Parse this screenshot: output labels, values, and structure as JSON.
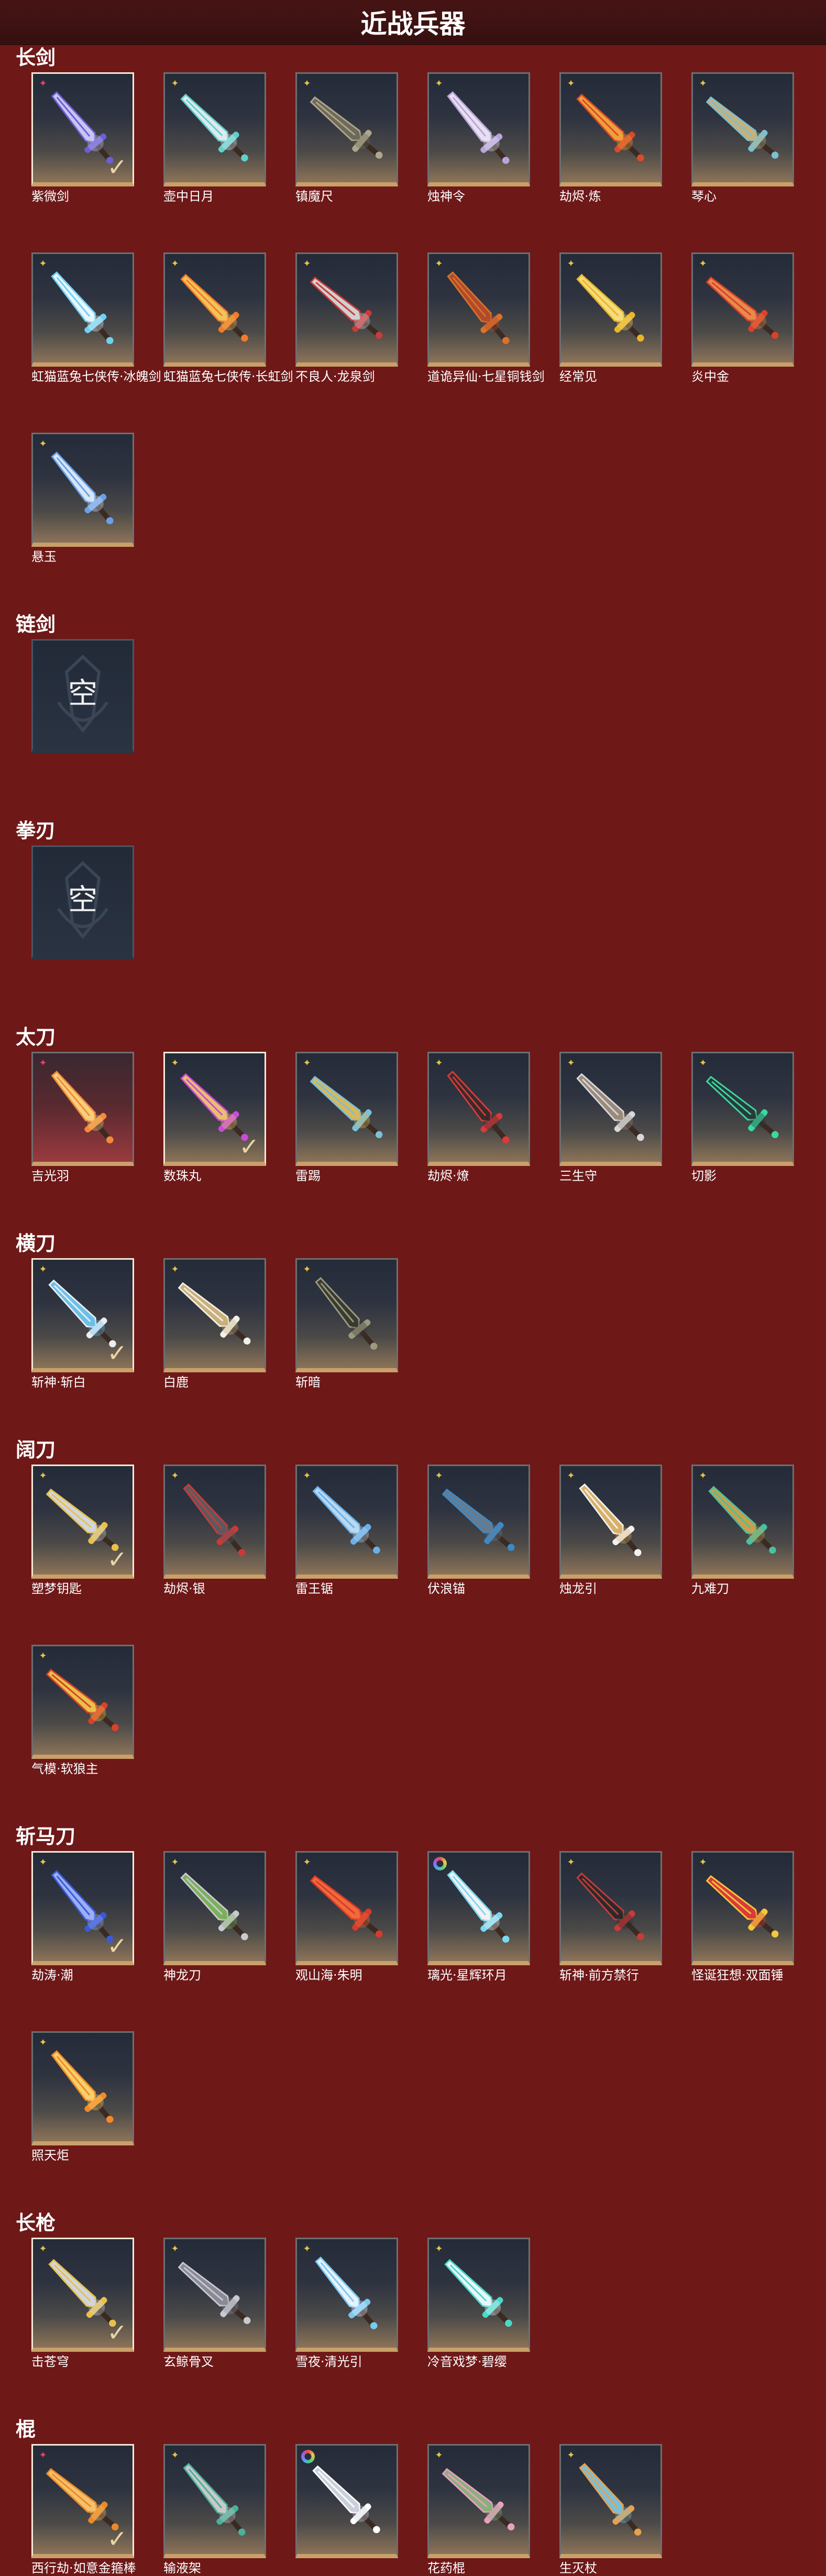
{
  "page": {
    "title": "近战兵器"
  },
  "colors": {
    "background": "#6e1818",
    "title_bar": "#3e1212",
    "card_border_gold": "#c9a06a",
    "selected_border": "#f3ead8",
    "badge_gold": "#e8c24a",
    "badge_star": "#e3436b"
  },
  "empty_slot_text": "空",
  "categories": [
    {
      "name": "长剑",
      "items": [
        {
          "name": "紫微剑",
          "badge": "star-icon",
          "selected": true,
          "colors": [
            "#6b5fd1",
            "#c9c4f2"
          ]
        },
        {
          "name": "壶中日月",
          "badge": "gold-cross-icon",
          "selected": false,
          "colors": [
            "#5fd1c9",
            "#dfe9f0"
          ]
        },
        {
          "name": "镇魔尺",
          "badge": "gold-cross-icon",
          "selected": false,
          "colors": [
            "#b0a68c",
            "#6d6a5a"
          ]
        },
        {
          "name": "烛神令",
          "badge": "gold-cross-icon",
          "selected": false,
          "colors": [
            "#b9a6d9",
            "#e8e0f2"
          ]
        },
        {
          "name": "劫烬·炼",
          "badge": "gold-cross-icon",
          "selected": false,
          "colors": [
            "#d94a2a",
            "#f0a03a"
          ]
        },
        {
          "name": "琴心",
          "badge": "gold-cross-icon",
          "selected": false,
          "colors": [
            "#7ac0d0",
            "#c9b07a"
          ]
        },
        {
          "name": "虹猫蓝兔七侠传·冰魄剑",
          "badge": "gold-cross-icon",
          "selected": false,
          "colors": [
            "#6fd0f2",
            "#e9f6fb"
          ]
        },
        {
          "name": "虹猫蓝兔七侠传·长虹剑",
          "badge": "gold-cross-icon",
          "selected": false,
          "colors": [
            "#f27a2a",
            "#f2c35a"
          ]
        },
        {
          "name": "不良人·龙泉剑",
          "badge": "gold-cross-icon",
          "selected": false,
          "colors": [
            "#c93a3a",
            "#d0d0d0"
          ]
        },
        {
          "name": "道诡异仙·七星铜钱剑",
          "badge": "gold-cross-icon",
          "selected": false,
          "colors": [
            "#d9722a",
            "#b04a2a"
          ]
        },
        {
          "name": "经常见",
          "badge": "gold-cross-icon",
          "selected": false,
          "colors": [
            "#e9b52a",
            "#f6dc7a"
          ]
        },
        {
          "name": "炎中金",
          "badge": "gold-cross-icon",
          "selected": false,
          "colors": [
            "#d9412a",
            "#e98a4a"
          ]
        },
        {
          "name": "悬玉",
          "badge": "gold-cross-icon",
          "selected": false,
          "colors": [
            "#6aa0e9",
            "#d8e6f6"
          ]
        }
      ]
    },
    {
      "name": "链剑",
      "items": [
        {
          "empty": true
        }
      ]
    },
    {
      "name": "拳刃",
      "items": [
        {
          "empty": true
        }
      ]
    },
    {
      "name": "太刀",
      "items": [
        {
          "name": "吉光羽",
          "badge": "star-icon",
          "selected": false,
          "rare": true,
          "colors": [
            "#f28a3a",
            "#f6cf7a"
          ]
        },
        {
          "name": "数珠丸",
          "badge": "gold-cross-icon",
          "selected": true,
          "colors": [
            "#c94ad9",
            "#e9c06a"
          ]
        },
        {
          "name": "雷踢",
          "badge": "gold-cross-icon",
          "selected": false,
          "colors": [
            "#7ac0d9",
            "#d9b85a"
          ]
        },
        {
          "name": "劫烬·燎",
          "badge": "gold-cross-icon",
          "selected": false,
          "colors": [
            "#d93a3a",
            "#3a2a2a"
          ]
        },
        {
          "name": "三生守",
          "badge": "gold-cross-icon",
          "selected": false,
          "colors": [
            "#d8d8dc",
            "#9a8a7a"
          ]
        },
        {
          "name": "切影",
          "badge": "gold-cross-icon",
          "selected": false,
          "colors": [
            "#3ad9a0",
            "#2a3a3a"
          ]
        }
      ]
    },
    {
      "name": "横刀",
      "items": [
        {
          "name": "斩神·斩白",
          "badge": "gold-cross-icon",
          "selected": true,
          "colors": [
            "#e9eef2",
            "#6ac0e9"
          ]
        },
        {
          "name": "白鹿",
          "badge": "gold-cross-icon",
          "selected": false,
          "colors": [
            "#f2efe6",
            "#c9b07a"
          ]
        },
        {
          "name": "斩暗",
          "badge": "gold-cross-icon",
          "selected": false,
          "colors": [
            "#9a9a80",
            "#3a3a30"
          ]
        }
      ]
    },
    {
      "name": "阔刀",
      "items": [
        {
          "name": "塑梦钥匙",
          "badge": "gold-cross-icon",
          "selected": true,
          "colors": [
            "#e9c04a",
            "#cfd6df"
          ]
        },
        {
          "name": "劫烬·银",
          "badge": "gold-cross-icon",
          "selected": false,
          "colors": [
            "#c93a3a",
            "#5a5a60"
          ]
        },
        {
          "name": "雷王锯",
          "badge": "gold-cross-icon",
          "selected": false,
          "colors": [
            "#6ab0e9",
            "#b9d9f2"
          ]
        },
        {
          "name": "伏浪锚",
          "badge": "gold-cross-icon",
          "selected": false,
          "colors": [
            "#3a8ac9",
            "#6a7a8a"
          ]
        },
        {
          "name": "烛龙引",
          "badge": "gold-cross-icon",
          "selected": false,
          "colors": [
            "#f2f2f2",
            "#d9b06a"
          ]
        },
        {
          "name": "九难刀",
          "badge": "gold-cross-icon",
          "selected": false,
          "colors": [
            "#4ac0a0",
            "#c9a04a"
          ]
        },
        {
          "name": "气模·软狼主",
          "badge": "gold-cross-icon",
          "selected": false,
          "colors": [
            "#d9412a",
            "#e9c04a"
          ]
        }
      ]
    },
    {
      "name": "斩马刀",
      "items": [
        {
          "name": "劫涛·潮",
          "badge": "gold-cross-icon",
          "selected": true,
          "colors": [
            "#3a5ad9",
            "#9ab0f2"
          ]
        },
        {
          "name": "神龙刀",
          "badge": "gold-cross-icon",
          "selected": false,
          "colors": [
            "#c9c9cf",
            "#7ab05a"
          ]
        },
        {
          "name": "观山海·朱明",
          "badge": "gold-cross-icon",
          "selected": false,
          "colors": [
            "#d93a2a",
            "#f26a3a"
          ]
        },
        {
          "name": "璃光·星辉环月",
          "badge": "rainbow-ring-icon",
          "selected": false,
          "colors": [
            "#7ad9f2",
            "#f2f2f2"
          ]
        },
        {
          "name": "斩神·前方禁行",
          "badge": "gold-cross-icon",
          "selected": false,
          "colors": [
            "#c93a3a",
            "#2a2a2a"
          ]
        },
        {
          "name": "怪诞狂想·双面锤",
          "badge": "gold-cross-icon",
          "selected": false,
          "colors": [
            "#f2c93a",
            "#d93a3a"
          ]
        },
        {
          "name": "照天炬",
          "badge": "gold-cross-icon",
          "selected": false,
          "colors": [
            "#f28a2a",
            "#f6d06a"
          ]
        }
      ]
    },
    {
      "name": "长枪",
      "items": [
        {
          "name": "击苍穹",
          "badge": "gold-cross-icon",
          "selected": true,
          "colors": [
            "#e9c04a",
            "#cfd6df"
          ]
        },
        {
          "name": "玄鲸骨叉",
          "badge": "gold-cross-icon",
          "selected": false,
          "colors": [
            "#c9c9d0",
            "#8a8a96"
          ]
        },
        {
          "name": "雪夜·清光引",
          "badge": "gold-cross-icon",
          "selected": false,
          "colors": [
            "#7ac9f2",
            "#e9f2fb"
          ]
        },
        {
          "name": "冷音戏梦·碧缨",
          "badge": "gold-cross-icon",
          "selected": false,
          "colors": [
            "#4ad9c9",
            "#e9f6fb"
          ]
        }
      ]
    },
    {
      "name": "棍",
      "items": [
        {
          "name": "西行劫·如意金箍棒",
          "badge": "star-icon",
          "selected": true,
          "colors": [
            "#e98a2a",
            "#f6c06a"
          ]
        },
        {
          "name": "输液架",
          "badge": "gold-cross-icon",
          "selected": false,
          "colors": [
            "#4ab09a",
            "#c9c9c9"
          ]
        },
        {
          "name": "",
          "badge": "rainbow-ring-icon",
          "selected": false,
          "colors": [
            "#ffffff",
            "#c9d0d9"
          ]
        },
        {
          "name": "花药棍",
          "badge": "gold-cross-icon",
          "selected": false,
          "colors": [
            "#e9a0c0",
            "#8ab07a"
          ]
        },
        {
          "name": "生灭杖",
          "badge": "gold-cross-icon",
          "selected": false,
          "colors": [
            "#e9a04a",
            "#7ac0d9"
          ]
        }
      ]
    }
  ]
}
